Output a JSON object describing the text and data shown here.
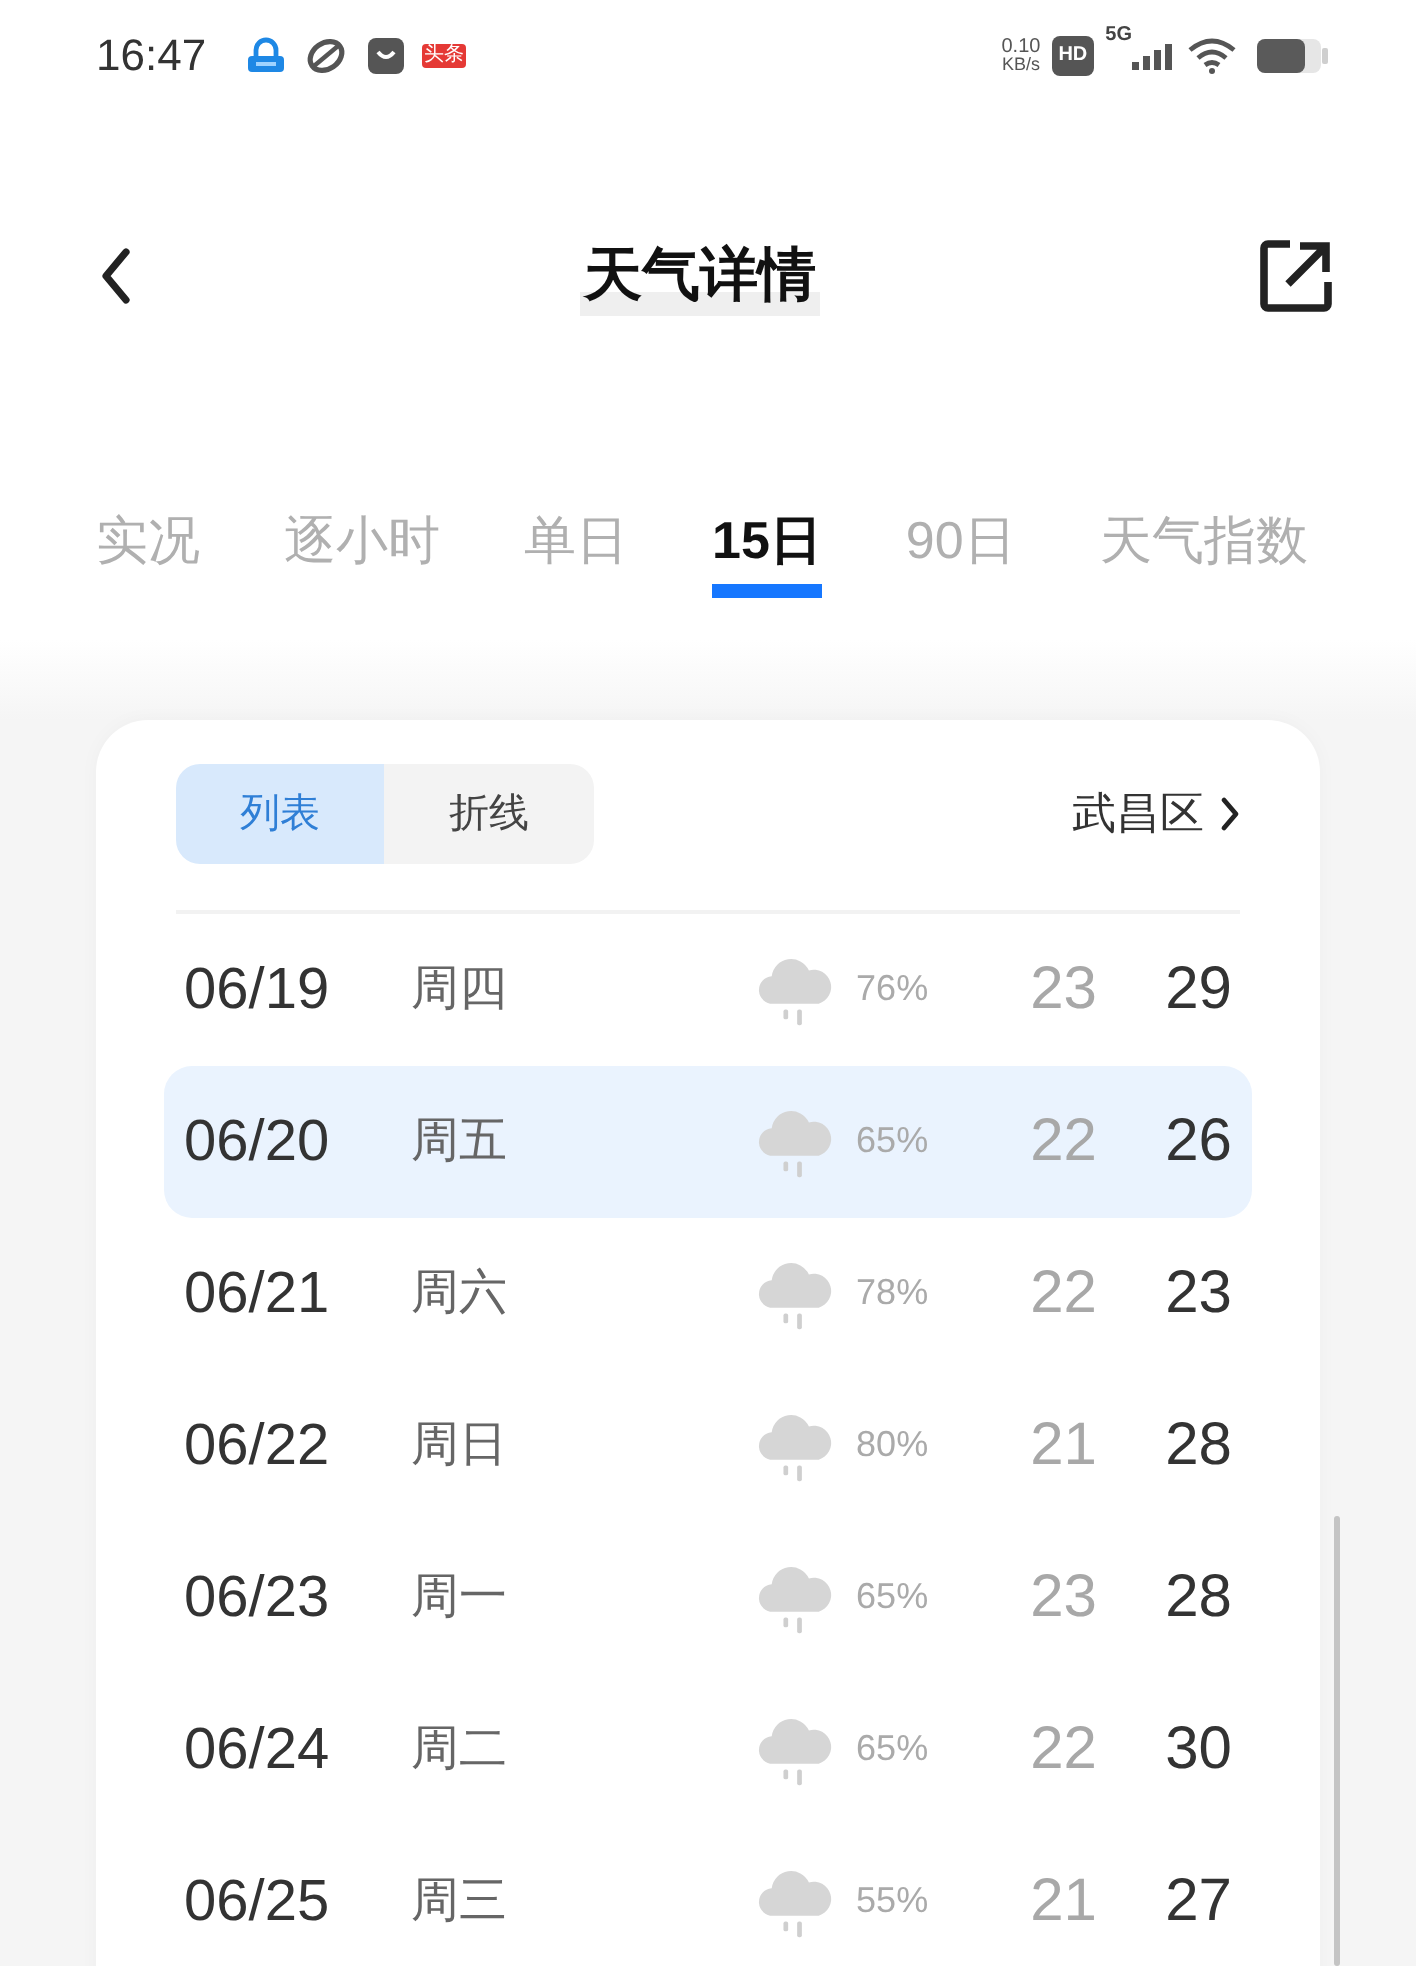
{
  "status_bar": {
    "time": "16:47",
    "app_badge": "头条",
    "network_speed": "0.10",
    "network_speed_unit": "KB/s",
    "hd_badge": "HD",
    "network_type": "5G"
  },
  "header": {
    "title": "天气详情"
  },
  "tabs": [
    {
      "label": "实况",
      "selected": false
    },
    {
      "label": "逐小时",
      "selected": false
    },
    {
      "label": "单日",
      "selected": false
    },
    {
      "label": "15日",
      "selected": true
    },
    {
      "label": "90日",
      "selected": false
    },
    {
      "label": "天气指数",
      "selected": false
    }
  ],
  "card": {
    "view_toggle": [
      {
        "label": "列表",
        "selected": true
      },
      {
        "label": "折线",
        "selected": false
      }
    ],
    "location": "武昌区",
    "rows": [
      {
        "date": "06/19",
        "weekday": "周四",
        "precipitation": "76%",
        "low": "23",
        "high": "29",
        "selected": false
      },
      {
        "date": "06/20",
        "weekday": "周五",
        "precipitation": "65%",
        "low": "22",
        "high": "26",
        "selected": true
      },
      {
        "date": "06/21",
        "weekday": "周六",
        "precipitation": "78%",
        "low": "22",
        "high": "23",
        "selected": false
      },
      {
        "date": "06/22",
        "weekday": "周日",
        "precipitation": "80%",
        "low": "21",
        "high": "28",
        "selected": false
      },
      {
        "date": "06/23",
        "weekday": "周一",
        "precipitation": "65%",
        "low": "23",
        "high": "28",
        "selected": false
      },
      {
        "date": "06/24",
        "weekday": "周二",
        "precipitation": "65%",
        "low": "22",
        "high": "30",
        "selected": false
      },
      {
        "date": "06/25",
        "weekday": "周三",
        "precipitation": "55%",
        "low": "21",
        "high": "27",
        "selected": false
      }
    ]
  }
}
